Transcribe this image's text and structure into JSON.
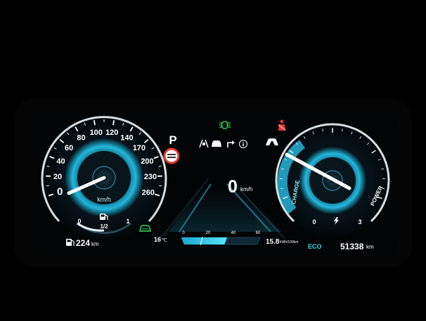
{
  "gear": "P",
  "speed": {
    "value": "0",
    "unit": "km/h"
  },
  "speedometer": {
    "unit": "km/h",
    "ticks": [
      "0",
      "20",
      "40",
      "60",
      "80",
      "100",
      "120",
      "140",
      "170",
      "200",
      "230",
      "260"
    ],
    "needle_value_kmh": 0
  },
  "fuel_gauge": {
    "empty": "0",
    "half": "1/2",
    "full": "1",
    "level_fraction": 0.5
  },
  "power_gauge": {
    "charge_label": "CHARGE",
    "power_label": "POWER",
    "ticks": [
      "0",
      "3"
    ],
    "needle_position_fraction": 0.1
  },
  "range": {
    "value": "224",
    "unit": "km"
  },
  "outside_temp": {
    "value": "16",
    "unit": "℃"
  },
  "fuel_economy": {
    "ticks": [
      "0",
      "20",
      "40",
      "60"
    ],
    "value": "15.8",
    "unit": "kWh/100km",
    "bar_fraction": 0.55
  },
  "drive_mode": "ECO",
  "odometer": {
    "value": "51338",
    "unit": "km"
  },
  "colors": {
    "accent": "#27b4d6",
    "gauge_glow": "#4fe0ff",
    "ring": "#eef6fa",
    "warning_red": "#e8352f",
    "indicator_green": "#3adf5c",
    "eco_cyan": "#3fd0e8"
  },
  "icons": [
    "headlight-indicator-icon",
    "seatbelt-warning-icon",
    "speed-limit-sign-icon",
    "lane-assist-icon",
    "vehicle-ahead-icon",
    "navigation-turn-icon",
    "info-icon",
    "forward-collision-icon",
    "fuel-pump-icon",
    "car-ready-icon",
    "lightning-icon",
    "range-fuel-icon"
  ]
}
